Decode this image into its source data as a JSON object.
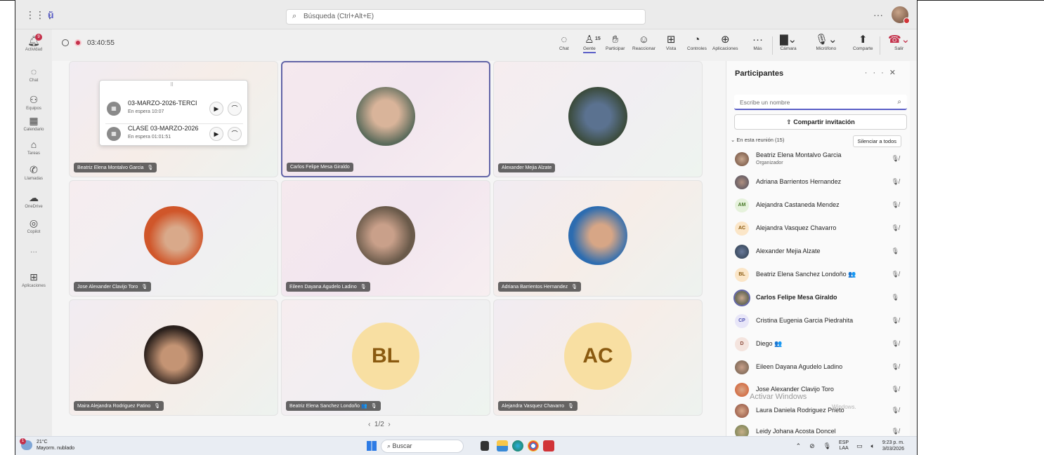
{
  "titlebar": {
    "search_placeholder": "Búsqueda (Ctrl+Alt+E)",
    "more": "···"
  },
  "rail": [
    {
      "label": "Actividad",
      "icon": "bell-icon",
      "badge": "9"
    },
    {
      "label": "Chat",
      "icon": "chat-icon"
    },
    {
      "label": "Equipos",
      "icon": "teams-icon"
    },
    {
      "label": "Calendario",
      "icon": "calendar-icon"
    },
    {
      "label": "Tareas",
      "icon": "tasks-icon"
    },
    {
      "label": "Llamadas",
      "icon": "phone-icon"
    },
    {
      "label": "OneDrive",
      "icon": "cloud-icon"
    },
    {
      "label": "Copilot",
      "icon": "copilot-icon"
    },
    {
      "label": "···",
      "icon": "more-icon"
    },
    {
      "label": "Aplicaciones",
      "icon": "plus-icon"
    }
  ],
  "meeting": {
    "elapsed": "03:40:55",
    "people_count": "15",
    "tools": [
      {
        "label": "Chat",
        "icon": "chat-icon"
      },
      {
        "label": "Gente",
        "icon": "people-icon"
      },
      {
        "label": "Participar",
        "icon": "hand-icon"
      },
      {
        "label": "Reaccionar",
        "icon": "emoji-icon"
      },
      {
        "label": "Vista",
        "icon": "grid-icon"
      },
      {
        "label": "Controles",
        "icon": "control-icon"
      },
      {
        "label": "Aplicaciones",
        "icon": "plus-icon"
      },
      {
        "label": "Más",
        "icon": "more-icon"
      },
      {
        "label": "Cámara",
        "icon": "camera-off-icon"
      },
      {
        "label": "Micrófono",
        "icon": "mic-off-icon"
      },
      {
        "label": "Comparte",
        "icon": "share-icon"
      },
      {
        "label": "Salir",
        "icon": "hangup-icon"
      }
    ]
  },
  "waiting_calls": [
    {
      "title": "03-MARZO-2026-TERCI",
      "status": "En espera",
      "time": "10:07"
    },
    {
      "title": "CLASE 03-MARZO-2026",
      "status": "En espera",
      "time": "01:01:51"
    }
  ],
  "tiles": [
    {
      "name": "Beatriz Elena Montalvo Garcia",
      "type": "photo",
      "color": "#8a7a6a"
    },
    {
      "name": "Carlos Felipe Mesa Giraldo",
      "type": "photo",
      "color": "#4a5a4a"
    },
    {
      "name": "Alexander Mejia Alzate",
      "type": "photo",
      "color": "#3a4f6a"
    },
    {
      "name": "Jose Alexander Clavijo Toro",
      "type": "photo",
      "color": "#c0582a"
    },
    {
      "name": "Eileen Dayana Agudelo Ladino",
      "type": "photo",
      "color": "#9a8a7a"
    },
    {
      "name": "Adriana Barrientos Hernandez",
      "type": "photo",
      "color": "#2c6cb0"
    },
    {
      "name": "Maira Alejandra Rodriguez Patino",
      "type": "photo",
      "color": "#3a2a24"
    },
    {
      "name": "Beatriz Elena Sanchez Londoño 👥",
      "type": "initials",
      "initials": "BL"
    },
    {
      "name": "Alejandra Vasquez Chavarro",
      "type": "initials",
      "initials": "AC"
    }
  ],
  "pager": "1/2",
  "panel": {
    "title": "Participantes",
    "search_placeholder": "Escribe un nombre",
    "invite_label": "Compartir invitación",
    "section_label": "En esta reunión (15)",
    "mute_all": "Silenciar a todos",
    "people": [
      {
        "name": "Beatriz Elena Montalvo Garcia",
        "role": "Organizador",
        "avatar": "photo",
        "mic": "off"
      },
      {
        "name": "Adriana Barrientos Hernandez",
        "avatar": "photo",
        "mic": "off"
      },
      {
        "name": "Alejandra Castaneda Mendez",
        "avatar": "AM",
        "mic": "off"
      },
      {
        "name": "Alejandra Vasquez Chavarro",
        "avatar": "AC",
        "mic": "off"
      },
      {
        "name": "Alexander Mejia Alzate",
        "avatar": "photo",
        "mic": "on"
      },
      {
        "name": "Beatriz Elena Sanchez Londoño 👥",
        "avatar": "BL",
        "mic": "off"
      },
      {
        "name": "Carlos Felipe Mesa Giraldo",
        "avatar": "photo",
        "mic": "on",
        "bold": true
      },
      {
        "name": "Cristina Eugenia Garcia Piedrahita",
        "avatar": "CP",
        "mic": "off"
      },
      {
        "name": "Diego 👥",
        "avatar": "D",
        "mic": "off"
      },
      {
        "name": "Eileen Dayana Agudelo Ladino",
        "avatar": "photo",
        "mic": "off"
      },
      {
        "name": "Jose Alexander Clavijo Toro",
        "avatar": "photo",
        "mic": "off"
      },
      {
        "name": "Laura Daniela Rodriguez Prieto",
        "avatar": "photo",
        "mic": "off"
      },
      {
        "name": "Leidy Johana Acosta Doncel",
        "avatar": "photo",
        "mic": "off"
      }
    ],
    "watermark_title": "Activar Windows",
    "watermark_sub": "Windows."
  },
  "taskbar": {
    "temp": "21°C",
    "weather": "Mayorm. nublado",
    "weather_badge": "1",
    "search": "Buscar",
    "lang1": "ESP",
    "lang2": "LAA",
    "time": "9:23 p. m.",
    "date": "3/03/2026"
  }
}
